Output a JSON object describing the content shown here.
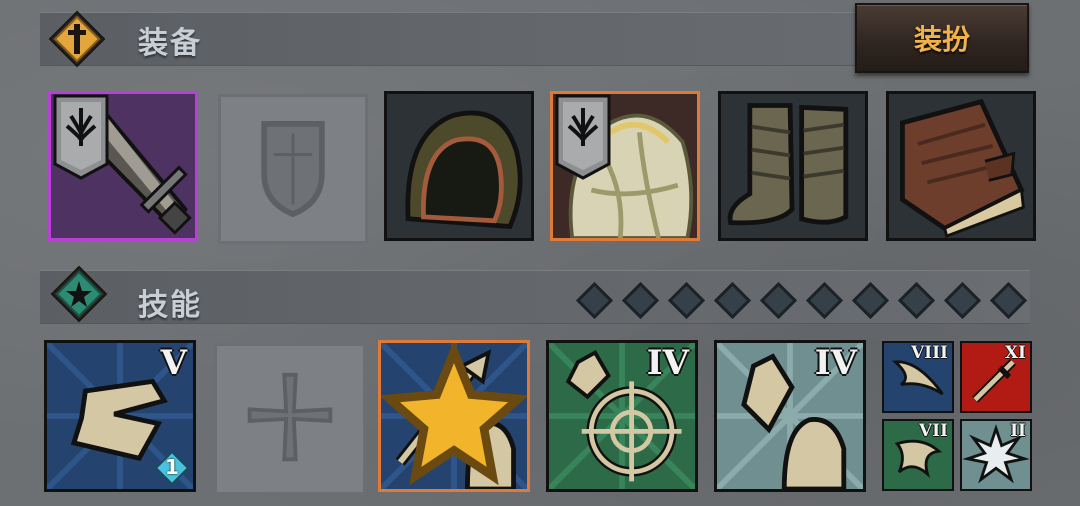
{
  "equipment": {
    "title": "装备",
    "dress_button": "装扮",
    "slots": [
      {
        "name": "sword",
        "rarity": "purple",
        "icon": "sword-icon",
        "has_banner": true
      },
      {
        "name": "shield",
        "rarity": "empty",
        "icon": "shield-icon",
        "has_banner": false
      },
      {
        "name": "hood",
        "rarity": "normal",
        "icon": "hood-icon",
        "has_banner": false
      },
      {
        "name": "armor",
        "rarity": "orange",
        "icon": "armor-icon",
        "has_banner": true
      },
      {
        "name": "boots",
        "rarity": "normal",
        "icon": "boots-icon",
        "has_banner": false
      },
      {
        "name": "book",
        "rarity": "normal",
        "icon": "book-icon",
        "has_banner": false
      }
    ]
  },
  "skills": {
    "title": "技能",
    "pip_count": 10,
    "main": [
      {
        "icon": "bandage-strike-icon",
        "level": "V",
        "badge": "1"
      },
      {
        "icon": "cross-icon",
        "level": ""
      },
      {
        "icon": "staff-icon",
        "level": "",
        "starred": true
      },
      {
        "icon": "target-crystal-icon",
        "level": "IV"
      },
      {
        "icon": "crystal-hand-icon",
        "level": "IV"
      }
    ],
    "mini": [
      {
        "icon": "wing-icon",
        "level": "VIII"
      },
      {
        "icon": "red-sword-icon",
        "level": "XI"
      },
      {
        "icon": "claw-icon",
        "level": "VII"
      },
      {
        "icon": "burst-icon",
        "level": "II"
      }
    ]
  },
  "colors": {
    "purple_rarity": "#b840d8",
    "orange_rarity": "#e07a38",
    "button_text": "#f2b24a",
    "title_text": "#c8ced6"
  }
}
